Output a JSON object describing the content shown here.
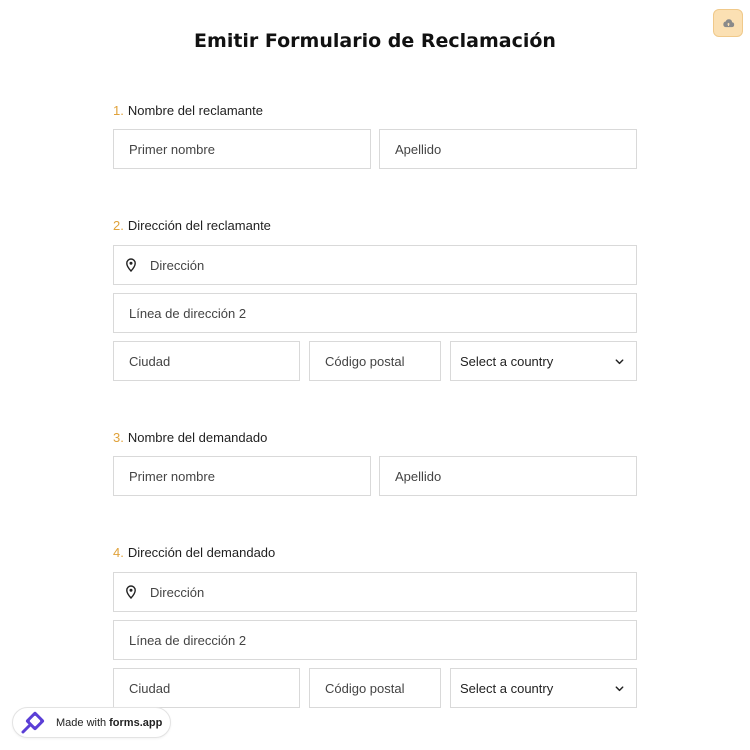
{
  "form": {
    "title": "Emitir Formulario de Reclamación"
  },
  "sections": [
    {
      "number": "1.",
      "label": "Nombre del reclamante",
      "first_name_placeholder": "Primer nombre",
      "last_name_placeholder": "Apellido"
    },
    {
      "number": "2.",
      "label": "Dirección del reclamante",
      "address_placeholder": "Dirección",
      "address2_placeholder": "Línea de dirección 2",
      "city_placeholder": "Ciudad",
      "postal_placeholder": "Código postal",
      "country_value": "Select a country"
    },
    {
      "number": "3.",
      "label": "Nombre del demandado",
      "first_name_placeholder": "Primer nombre",
      "last_name_placeholder": "Apellido"
    },
    {
      "number": "4.",
      "label": "Dirección del demandado",
      "address_placeholder": "Dirección",
      "address2_placeholder": "Línea de dirección 2",
      "city_placeholder": "Ciudad",
      "postal_placeholder": "Código postal",
      "country_value": "Select a country"
    }
  ],
  "badge": {
    "prefix": "Made with",
    "brand": "forms.app"
  },
  "icons": {
    "save": "cloud-upload-icon",
    "address": "map-pin-icon",
    "country": "chevron-down-icon",
    "brand": "forms-app-logo-icon"
  },
  "colors": {
    "accent": "#e0a23a",
    "save_button_bg": "#fbe0b3",
    "brand_logo": "#5b3fd6"
  }
}
